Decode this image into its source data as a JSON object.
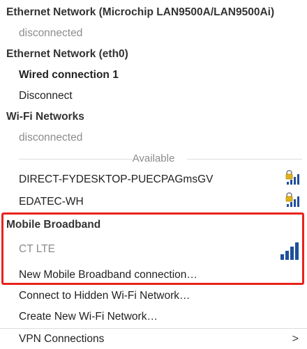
{
  "sections": {
    "ethernet_microchip": {
      "header": "Ethernet Network (Microchip LAN9500A/LAN9500Ai)",
      "status": "disconnected"
    },
    "ethernet_eth0": {
      "header": "Ethernet Network (eth0)",
      "active_connection": "Wired connection 1",
      "disconnect": "Disconnect"
    },
    "wifi": {
      "header": "Wi-Fi Networks",
      "status": "disconnected",
      "available_label": "Available",
      "networks": [
        {
          "ssid": "DIRECT-FYDESKTOP-PUECPAGmsGV",
          "secured": true,
          "signal_bars": 3
        },
        {
          "ssid": "EDATEC-WH",
          "secured": true,
          "signal_bars": 3
        }
      ]
    },
    "mobile_broadband": {
      "header": "Mobile Broadband",
      "device": "CT LTE",
      "device_signal_bars": 4,
      "new_connection": "New Mobile Broadband connection…"
    }
  },
  "actions": {
    "connect_hidden": "Connect to Hidden Wi-Fi Network…",
    "create_new": "Create New Wi-Fi Network…",
    "vpn": "VPN Connections",
    "vpn_chevron": ">"
  },
  "colors": {
    "highlight": "#e8221c",
    "signal_bars": "#1f4f9a",
    "lock": "#e0b020",
    "disabled_text": "#8c8c8c"
  }
}
